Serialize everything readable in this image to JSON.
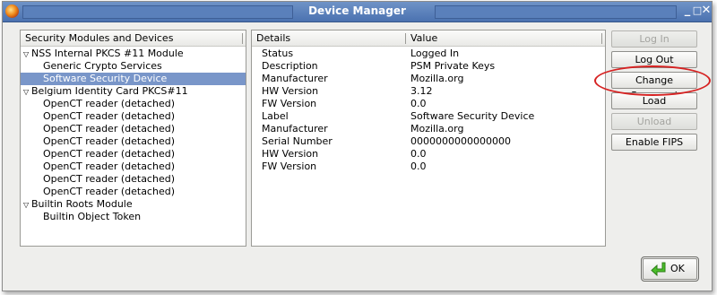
{
  "window": {
    "title": "Device Manager",
    "controls": [
      "_",
      "□",
      "✕"
    ]
  },
  "tree": {
    "header": "Security Modules and Devices",
    "rows": [
      {
        "label": "NSS Internal PKCS #11 Module",
        "level": 0,
        "expanded": true
      },
      {
        "label": "Generic Crypto Services",
        "level": 1
      },
      {
        "label": "Software Security Device",
        "level": 1,
        "selected": true
      },
      {
        "label": "Belgium Identity Card PKCS#11",
        "level": 0,
        "expanded": true
      },
      {
        "label": "OpenCT reader (detached)",
        "level": 1
      },
      {
        "label": "OpenCT reader (detached)",
        "level": 1
      },
      {
        "label": "OpenCT reader (detached)",
        "level": 1
      },
      {
        "label": "OpenCT reader (detached)",
        "level": 1
      },
      {
        "label": "OpenCT reader (detached)",
        "level": 1
      },
      {
        "label": "OpenCT reader (detached)",
        "level": 1
      },
      {
        "label": "OpenCT reader (detached)",
        "level": 1
      },
      {
        "label": "OpenCT reader (detached)",
        "level": 1
      },
      {
        "label": "Builtin Roots Module",
        "level": 0,
        "expanded": true
      },
      {
        "label": "Builtin Object Token",
        "level": 1
      }
    ]
  },
  "details": {
    "headers": {
      "details": "Details",
      "value": "Value"
    },
    "rows": [
      {
        "detail": "Status",
        "value": "Logged In"
      },
      {
        "detail": "Description",
        "value": "PSM Private Keys"
      },
      {
        "detail": "Manufacturer",
        "value": "Mozilla.org"
      },
      {
        "detail": "HW Version",
        "value": "3.12"
      },
      {
        "detail": "FW Version",
        "value": "0.0"
      },
      {
        "detail": "Label",
        "value": "Software Security Device"
      },
      {
        "detail": "Manufacturer",
        "value": "Mozilla.org"
      },
      {
        "detail": "Serial Number",
        "value": "0000000000000000"
      },
      {
        "detail": "HW Version",
        "value": "0.0"
      },
      {
        "detail": "FW Version",
        "value": "0.0"
      }
    ]
  },
  "buttons": {
    "log_in": {
      "label": "Log In",
      "enabled": false
    },
    "log_out": {
      "label": "Log Out",
      "enabled": true
    },
    "change_password": {
      "label": "Change Password",
      "enabled": true
    },
    "load": {
      "label": "Load",
      "enabled": true
    },
    "unload": {
      "label": "Unload",
      "enabled": false
    },
    "enable_fips": {
      "label": "Enable FIPS",
      "enabled": true
    },
    "ok": {
      "label": "OK",
      "icon": "green-arrow-icon"
    }
  },
  "annotation": {
    "color": "#d62222",
    "target": "Change Password"
  }
}
